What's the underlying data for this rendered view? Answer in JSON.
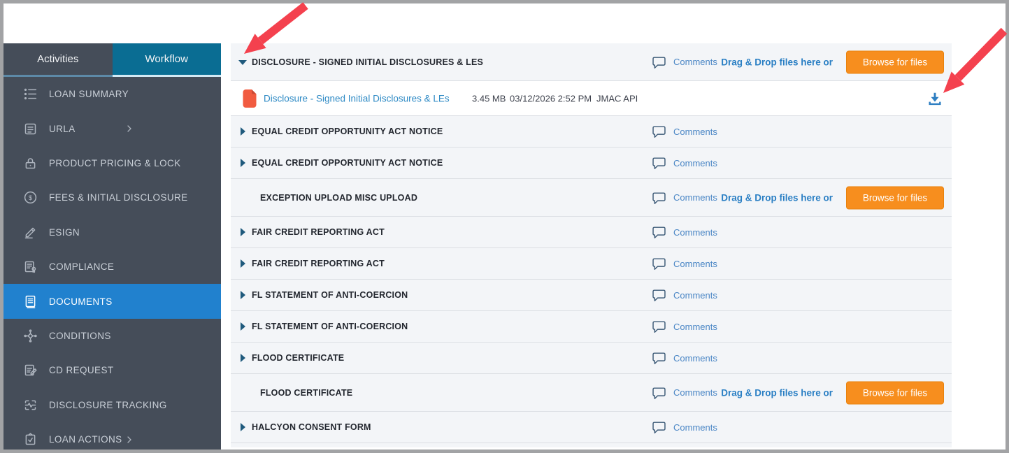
{
  "colors": {
    "sidebar_bg": "#454d59",
    "active_tab": "#0a6d93",
    "selected_item": "#2181ce",
    "accent_orange": "#f78e1e",
    "link_blue": "#2e8ac5",
    "arrow_red": "#f4414e",
    "caret_blue": "#1f5a7d",
    "row_bg": "#f3f5f8"
  },
  "sidebar": {
    "tabs": [
      {
        "label": "Activities",
        "active": false
      },
      {
        "label": "Workflow",
        "active": true
      }
    ],
    "items": [
      {
        "label": "LOAN SUMMARY",
        "icon": "list",
        "selected": false,
        "chevron": false
      },
      {
        "label": "URLA",
        "icon": "urla-doc",
        "selected": false,
        "chevron": true
      },
      {
        "label": "PRODUCT PRICING & LOCK",
        "icon": "lock",
        "selected": false,
        "chevron": false
      },
      {
        "label": "FEES & INITIAL DISCLOSURE",
        "icon": "dollar",
        "selected": false,
        "chevron": false
      },
      {
        "label": "ESIGN",
        "icon": "pen",
        "selected": false,
        "chevron": false
      },
      {
        "label": "COMPLIANCE",
        "icon": "certificate",
        "selected": false,
        "chevron": false
      },
      {
        "label": "DOCUMENTS",
        "icon": "document",
        "selected": true,
        "chevron": false
      },
      {
        "label": "CONDITIONS",
        "icon": "conditions",
        "selected": false,
        "chevron": false
      },
      {
        "label": "CD REQUEST",
        "icon": "clipboard-pen",
        "selected": false,
        "chevron": false
      },
      {
        "label": "DISCLOSURE TRACKING",
        "icon": "activity",
        "selected": false,
        "chevron": false
      },
      {
        "label": "LOAN ACTIONS",
        "icon": "clipboard-check",
        "selected": false,
        "chevron": true
      }
    ]
  },
  "documents": {
    "comments_label": "Comments",
    "dragdrop_label": "Drag & Drop files here or",
    "browse_label": "Browse for files",
    "rows": [
      {
        "title": "DISCLOSURE - SIGNED INITIAL DISCLOSURES & LES",
        "caret": "down",
        "upload": true,
        "header": true
      },
      {
        "title": "EQUAL CREDIT OPPORTUNITY ACT NOTICE",
        "caret": "right",
        "upload": false,
        "header": false
      },
      {
        "title": "EQUAL CREDIT OPPORTUNITY ACT NOTICE",
        "caret": "right",
        "upload": false,
        "header": false
      },
      {
        "title": "EXCEPTION UPLOAD MISC UPLOAD",
        "caret": "none",
        "upload": true,
        "header": false
      },
      {
        "title": "FAIR CREDIT REPORTING ACT",
        "caret": "right",
        "upload": false,
        "header": false
      },
      {
        "title": "FAIR CREDIT REPORTING ACT",
        "caret": "right",
        "upload": false,
        "header": false
      },
      {
        "title": "FL STATEMENT OF ANTI-COERCION",
        "caret": "right",
        "upload": false,
        "header": false
      },
      {
        "title": "FL STATEMENT OF ANTI-COERCION",
        "caret": "right",
        "upload": false,
        "header": false
      },
      {
        "title": "FLOOD CERTIFICATE",
        "caret": "right",
        "upload": false,
        "header": false
      },
      {
        "title": "FLOOD CERTIFICATE",
        "caret": "none",
        "upload": true,
        "header": false
      },
      {
        "title": "HALCYON CONSENT FORM",
        "caret": "right",
        "upload": false,
        "header": false
      }
    ],
    "file": {
      "name": "Disclosure - Signed Initial Disclosures & LEs",
      "size": "3.45 MB",
      "date": "03/12/2026 2:52 PM",
      "source": "JMAC API"
    }
  }
}
